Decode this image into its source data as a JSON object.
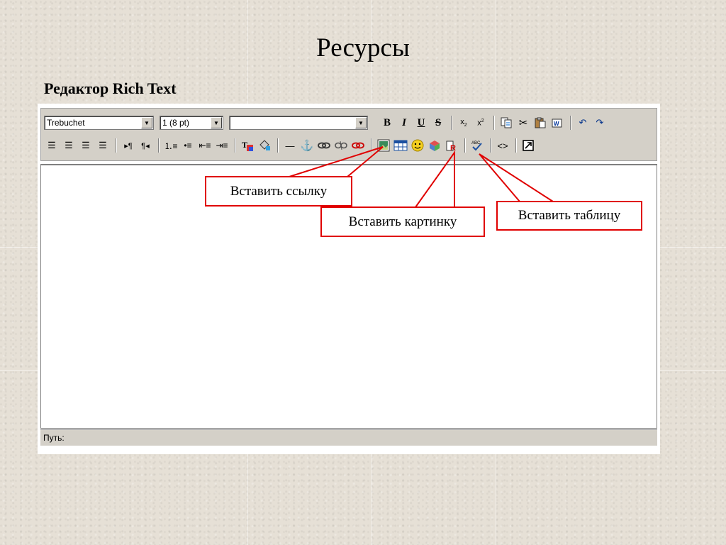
{
  "slide": {
    "title": "Ресурсы",
    "subtitle": "Редактор Rich Text"
  },
  "toolbar": {
    "font_value": "Trebuchet",
    "size_value": "1 (8 pt)",
    "format_value": "",
    "bold_label": "B",
    "italic_label": "I",
    "underline_label": "U",
    "strike_label": "S"
  },
  "statusbar": {
    "path_label": "Путь:"
  },
  "callouts": {
    "insert_link": "Вставить ссылку",
    "insert_image": "Вставить картинку",
    "insert_table": "Вставить таблицу"
  },
  "colors": {
    "callout_border": "#e00000",
    "toolbar_bg": "#d4d0c8"
  }
}
